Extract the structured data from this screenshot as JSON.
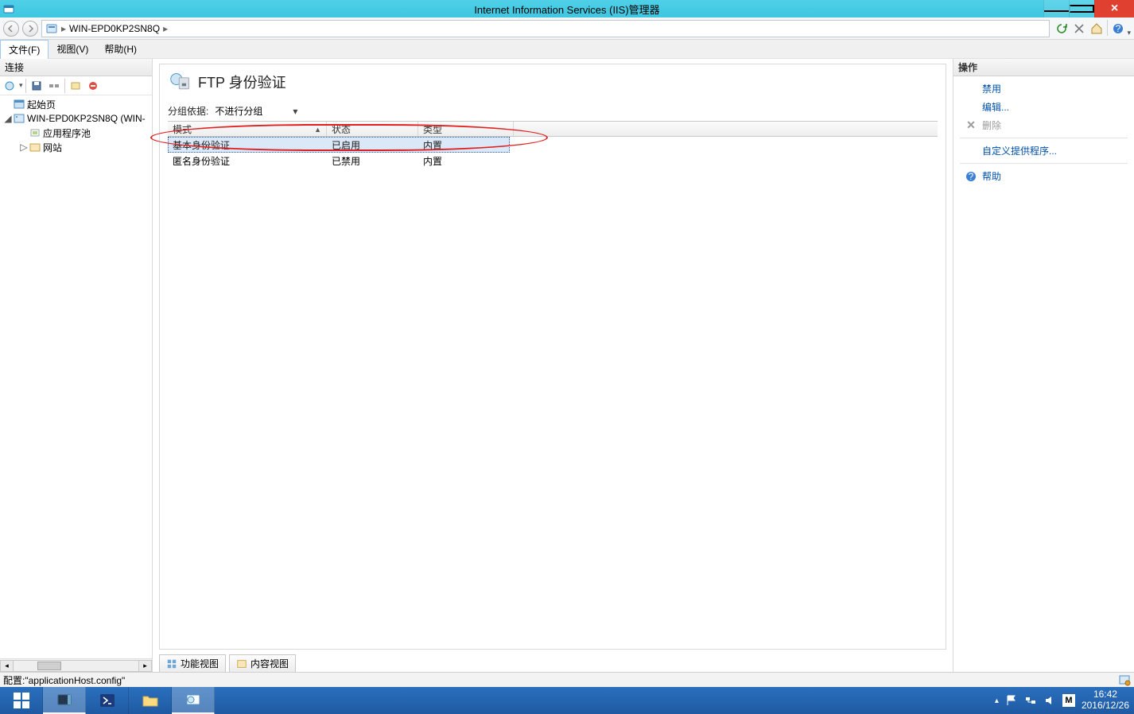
{
  "title": "Internet Information Services (IIS)管理器",
  "breadcrumb": {
    "server": "WIN-EPD0KP2SN8Q"
  },
  "menu": {
    "file": "文件(F)",
    "view": "视图(V)",
    "help": "帮助(H)"
  },
  "connections": {
    "header": "连接",
    "start_page": "起始页",
    "server_node": "WIN-EPD0KP2SN8Q (WIN-",
    "app_pools": "应用程序池",
    "sites": "网站"
  },
  "page": {
    "heading": "FTP 身份验证",
    "group_label": "分组依据:",
    "group_value": "不进行分组",
    "columns": {
      "mode": "模式",
      "state": "状态",
      "type": "类型"
    },
    "rows": [
      {
        "mode": "基本身份验证",
        "state": "已启用",
        "type": "内置",
        "selected": true
      },
      {
        "mode": "匿名身份验证",
        "state": "已禁用",
        "type": "内置",
        "selected": false
      }
    ],
    "view_feature": "功能视图",
    "view_content": "内容视图"
  },
  "actions": {
    "header": "操作",
    "disable": "禁用",
    "edit": "编辑...",
    "delete": "删除",
    "custom_providers": "自定义提供程序...",
    "help": "帮助"
  },
  "status": {
    "config": "配置:\"applicationHost.config\""
  },
  "tray": {
    "ime": "M",
    "time": "16:42",
    "date": "2016/12/26"
  }
}
